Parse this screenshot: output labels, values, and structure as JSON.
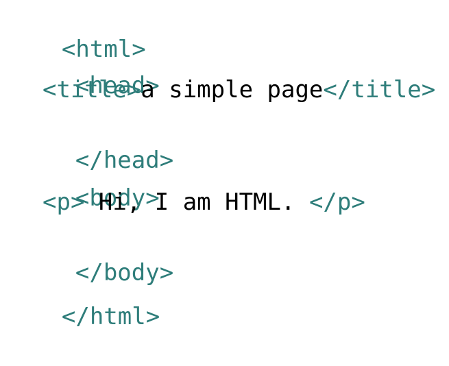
{
  "colors": {
    "tag": "#2e7d7a",
    "text": "#000000",
    "background": "#ffffff"
  },
  "code": {
    "line1": {
      "tag": "<html>"
    },
    "line2": {
      "tag": "<head>"
    },
    "line3": {
      "open_tag": "<title>",
      "content": "a simple page",
      "close_tag": "</title>"
    },
    "line4": {
      "tag": "</head>"
    },
    "line5": {
      "tag": "<body>"
    },
    "line6": {
      "open_tag": "<p>",
      "content": " Hi, I am HTML. ",
      "close_tag": "</p>"
    },
    "line7": {
      "tag": "</body>"
    },
    "line8": {
      "tag": "</html>"
    }
  }
}
